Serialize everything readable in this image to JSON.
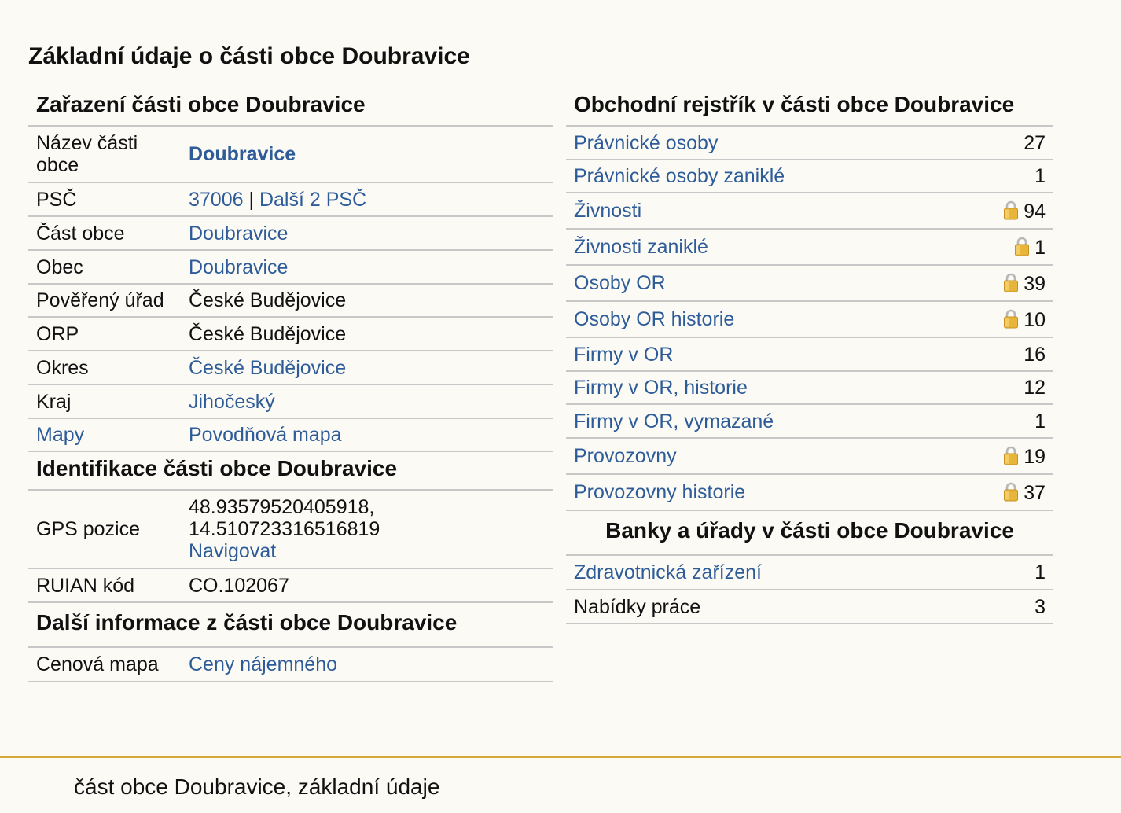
{
  "page_title": "Základní údaje o části obce Doubravice",
  "zarazeni": {
    "title": "Zařazení části obce Doubravice",
    "nazev_label": "Název části obce",
    "nazev_value": "Doubravice",
    "psc_label": "PSČ",
    "psc_value": "37006",
    "psc_separator": "|",
    "psc_more": "Další 2 PSČ",
    "cast_obce_label": "Část obce",
    "cast_obce_value": "Doubravice",
    "obec_label": "Obec",
    "obec_value": "Doubravice",
    "povereny_label": "Pověřený úřad",
    "povereny_value": "České Budějovice",
    "orp_label": "ORP",
    "orp_value": "České Budějovice",
    "okres_label": "Okres",
    "okres_value": "České Budějovice",
    "kraj_label": "Kraj",
    "kraj_value": "Jihočeský",
    "mapy_label": "Mapy",
    "mapy_value": "Povodňová mapa"
  },
  "identifikace": {
    "title": "Identifikace části obce Doubravice",
    "gps_label": "GPS pozice",
    "gps_lat": "48.93579520405918,",
    "gps_lon": "14.510723316516819",
    "gps_navigate": "Navigovat",
    "ruian_label": "RUIAN kód",
    "ruian_value": "CO.102067"
  },
  "dalsi": {
    "title": "Další informace z části obce Doubravice",
    "cenova_label": "Cenová mapa",
    "cenova_value": "Ceny nájemného"
  },
  "rejstrik": {
    "title": "Obchodní rejstřík v části obce Doubravice",
    "rows": [
      {
        "label": "Právnické osoby",
        "value": "27",
        "locked": false
      },
      {
        "label": "Právnické osoby zaniklé",
        "value": "1",
        "locked": false
      },
      {
        "label": "Živnosti",
        "value": "94",
        "locked": true
      },
      {
        "label": "Živnosti zaniklé",
        "value": "1",
        "locked": true
      },
      {
        "label": "Osoby OR",
        "value": "39",
        "locked": true
      },
      {
        "label": "Osoby OR historie",
        "value": "10",
        "locked": true
      },
      {
        "label": "Firmy v OR",
        "value": "16",
        "locked": false
      },
      {
        "label": "Firmy v OR, historie",
        "value": "12",
        "locked": false
      },
      {
        "label": "Firmy v OR, vymazané",
        "value": "1",
        "locked": false
      },
      {
        "label": "Provozovny",
        "value": "19",
        "locked": true
      },
      {
        "label": "Provozovny historie",
        "value": "37",
        "locked": true
      }
    ]
  },
  "banky": {
    "title": "Banky a úřady v části obce Doubravice",
    "rows": [
      {
        "label": "Zdravotnická zařízení",
        "value": "1",
        "link": true
      },
      {
        "label": "Nabídky práce",
        "value": "3",
        "link": false
      }
    ]
  },
  "footer": {
    "text": "část obce Doubravice, základní údaje"
  },
  "colors": {
    "link": "#2e5c99",
    "background": "#fbfaf5",
    "border": "#c8c8c8",
    "footer_accent": "#d4a93a",
    "lock": "#e7b53a"
  },
  "icons": {
    "lock": "padlock-icon"
  }
}
